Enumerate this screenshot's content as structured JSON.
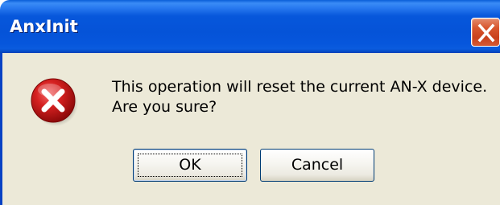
{
  "window": {
    "title": "AnxInit",
    "title_bar_color": "#0556d8",
    "body_color": "#ece9d8"
  },
  "titlebar": {
    "close_icon": "close-icon",
    "close_color": "#d8562e"
  },
  "dialog": {
    "icon": "error-icon",
    "icon_color": "#c8161d",
    "message_line1": "This operation will reset the current AN-X device.",
    "message_line2": "Are you sure?"
  },
  "buttons": {
    "ok_label": "OK",
    "cancel_label": "Cancel",
    "default": "OK"
  }
}
